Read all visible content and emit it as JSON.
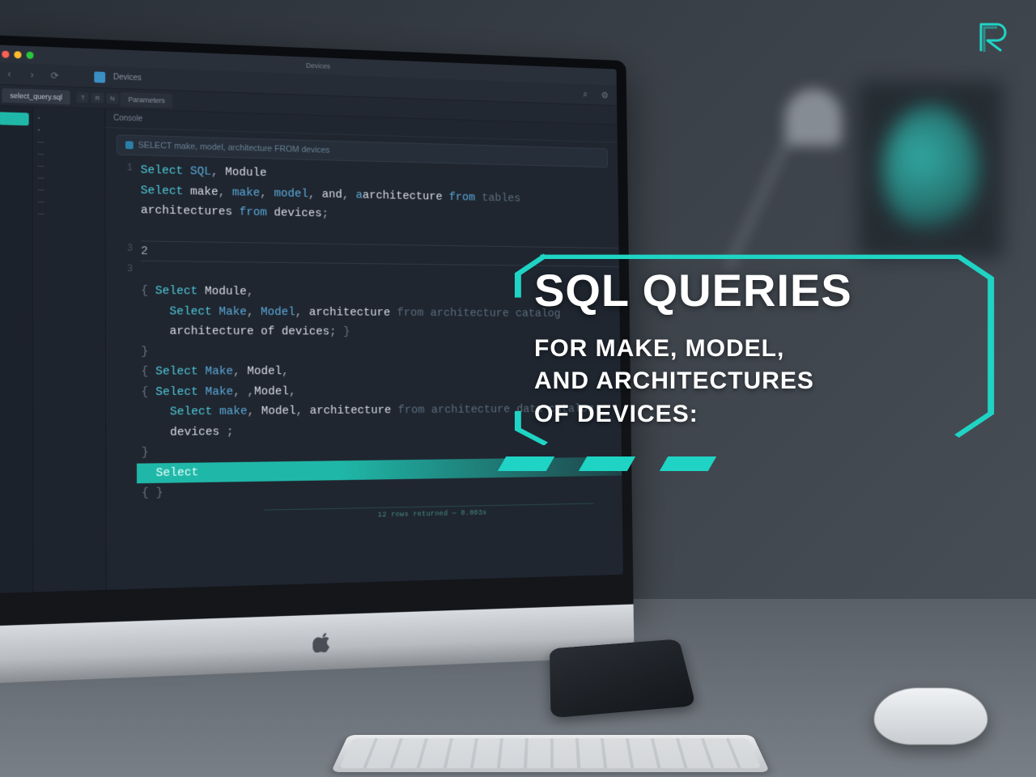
{
  "logo_label": "R",
  "window": {
    "title": "Devices",
    "toolbar_label": "Devices"
  },
  "tabs": {
    "main": "select_query.sql",
    "chips": [
      "T",
      "R",
      "N"
    ],
    "secondary": "Parameters"
  },
  "editor": {
    "header": "Console",
    "breadcrumb": "SELECT make, model, architecture FROM devices",
    "status": "12 rows returned — 0.003s"
  },
  "code": {
    "l1a": "Select",
    "l1b": "SQL",
    "l1c": "Module",
    "l2a": "Select",
    "l2b": "make",
    "l2c": "make",
    "l2d": "model",
    "l2e": "and",
    "l2f": "architecture",
    "l2g": "from",
    "l2h": "tables",
    "l3a": "architectures",
    "l3b": "from",
    "l3c": "devices",
    "l5": "2",
    "l7a": "Select",
    "l7b": "Module",
    "l8a": "Select",
    "l8b": "Make",
    "l8c": "Model",
    "l8d": "architecture",
    "l8e": "from",
    "l8f": "architecture catalog",
    "l9a": "architecture",
    "l9b": "of",
    "l9c": "devices",
    "l11a": "Select",
    "l11b": "Make",
    "l11c": "Model",
    "l12a": "Select",
    "l12b": "Make",
    "l12c": "Model",
    "l13a": "Select",
    "l13b": "make",
    "l13c": "Model",
    "l13d": "architecture",
    "l13e": "from",
    "l13f": "architecture data catalog",
    "l14a": "devices",
    "l16a": "Select"
  },
  "gutter": [
    "1",
    "",
    "",
    "",
    "3",
    "3",
    "",
    "",
    "",
    "",
    "",
    "",
    "",
    "",
    "",
    "",
    ""
  ],
  "explorer_lines": [
    "•",
    "•",
    "—",
    "—",
    "—",
    "—",
    "—",
    "—",
    "—",
    "—",
    "—",
    "—"
  ],
  "title_card": {
    "heading": "SQL QUERIES",
    "sub1": "FOR MAKE, MODEL,",
    "sub2": "AND ARCHITECTURES",
    "sub3": "OF DEVICES:"
  },
  "colors": {
    "accent": "#1fd4c4"
  }
}
